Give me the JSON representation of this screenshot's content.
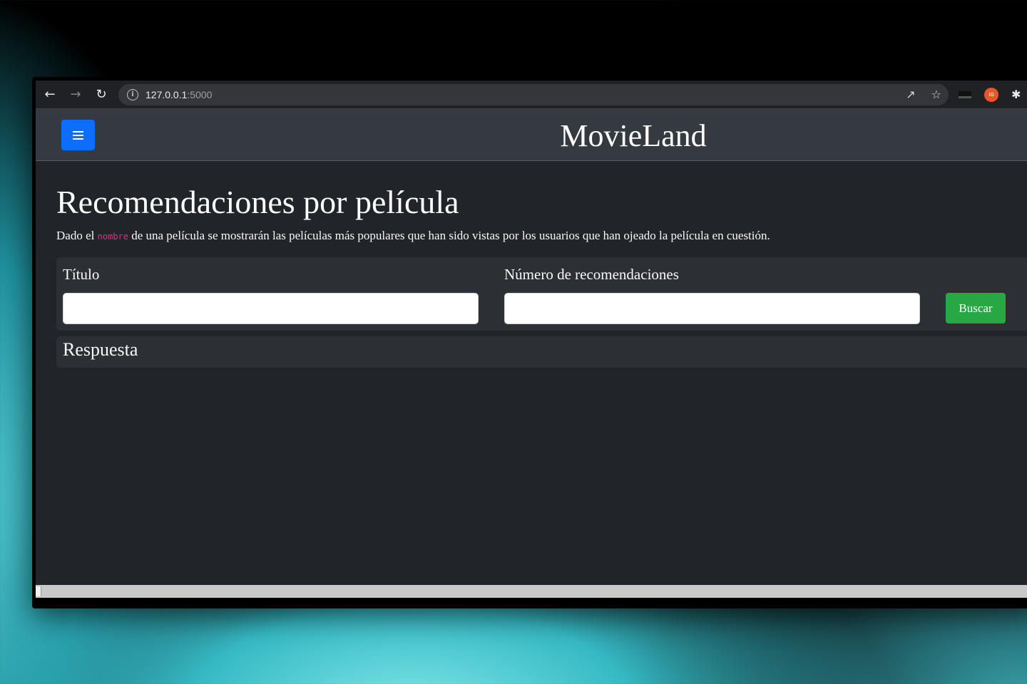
{
  "browser": {
    "url_host": "127.0.0.1",
    "url_port": ":5000",
    "icons": [
      "back-arrow-icon",
      "forward-arrow-icon",
      "reload-icon",
      "info-icon",
      "share-icon",
      "star-icon",
      "extension-icon",
      "puzzle-icon"
    ],
    "extension_badge": "IG"
  },
  "navbar": {
    "brand": "MovieLand",
    "menu_color": "#0d6efd"
  },
  "page": {
    "title": "Recomendaciones por película",
    "description_before": "Dado el ",
    "description_code": "nombre",
    "description_after": " de una película se mostrarán las películas más populares que han sido vistas por los usuarios que han ojeado la película en cuestión."
  },
  "form": {
    "title_label": "Título",
    "title_value": "",
    "count_label": "Número de recomendaciones",
    "count_value": "",
    "search_label": "Buscar",
    "search_color": "#28a745"
  },
  "answer": {
    "title": "Respuesta"
  }
}
